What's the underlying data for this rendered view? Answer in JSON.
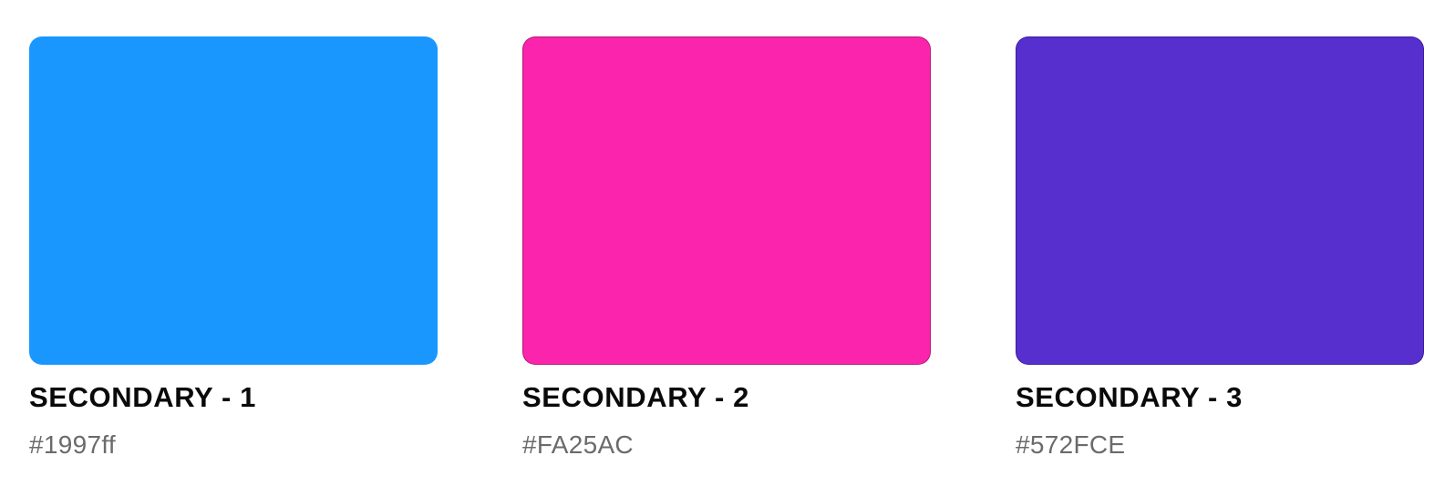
{
  "swatches": [
    {
      "name": "SECONDARY - 1",
      "hex": "#1997ff",
      "color": "#1997ff"
    },
    {
      "name": "SECONDARY - 2",
      "hex": "#FA25AC",
      "color": "#FA25AC"
    },
    {
      "name": "SECONDARY - 3",
      "hex": "#572FCE",
      "color": "#572FCE"
    }
  ]
}
